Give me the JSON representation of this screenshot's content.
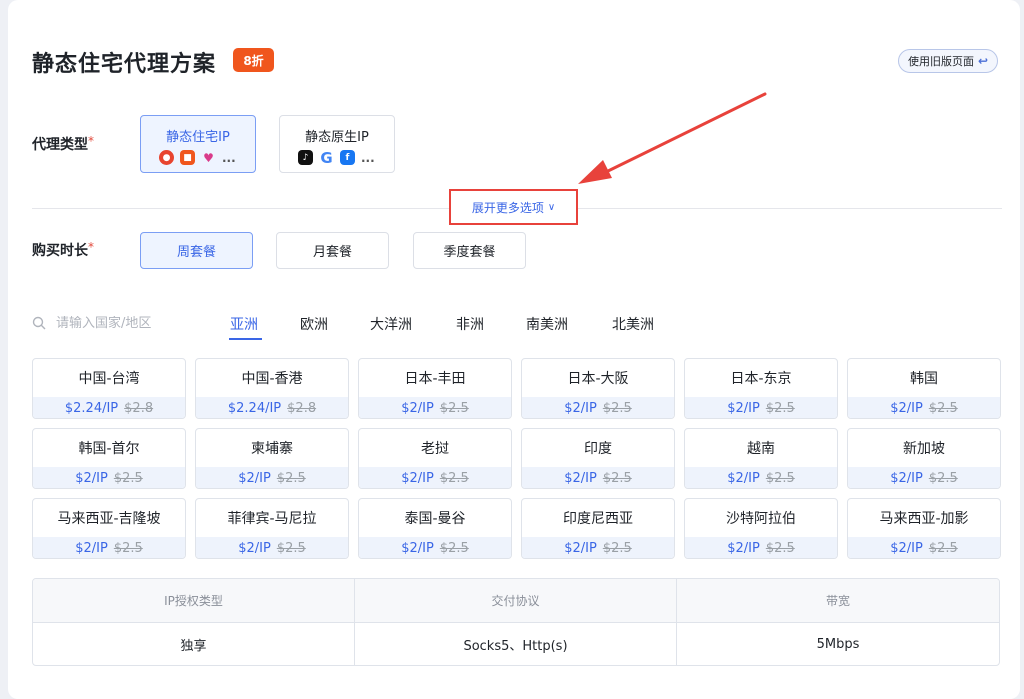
{
  "header": {
    "title": "静态住宅代理方案",
    "badge": "8折",
    "old_page_button": "使用旧版页面",
    "old_page_icon": "return-icon"
  },
  "proxy_type": {
    "label": "代理类型",
    "required_mark": "*",
    "options": [
      {
        "label": "静态住宅IP",
        "active": true,
        "icons": [
          "weibo-icon",
          "taobao-icon",
          "lazada-icon"
        ],
        "more": "..."
      },
      {
        "label": "静态原生IP",
        "active": false,
        "icons": [
          "tiktok-icon",
          "google-icon",
          "facebook-icon"
        ],
        "more": "..."
      }
    ],
    "expand_label": "展开更多选项"
  },
  "duration": {
    "label": "购买时长",
    "required_mark": "*",
    "options": [
      {
        "label": "周套餐",
        "active": true
      },
      {
        "label": "月套餐",
        "active": false
      },
      {
        "label": "季度套餐",
        "active": false
      }
    ]
  },
  "search": {
    "placeholder": "请输入国家/地区"
  },
  "regions": [
    {
      "label": "亚洲",
      "active": true
    },
    {
      "label": "欧洲",
      "active": false
    },
    {
      "label": "大洋洲",
      "active": false
    },
    {
      "label": "非洲",
      "active": false
    },
    {
      "label": "南美洲",
      "active": false
    },
    {
      "label": "北美洲",
      "active": false
    }
  ],
  "locations": [
    {
      "name": "中国-台湾",
      "price": "$2.24/IP",
      "original": "$2.8"
    },
    {
      "name": "中国-香港",
      "price": "$2.24/IP",
      "original": "$2.8"
    },
    {
      "name": "日本-丰田",
      "price": "$2/IP",
      "original": "$2.5"
    },
    {
      "name": "日本-大阪",
      "price": "$2/IP",
      "original": "$2.5"
    },
    {
      "name": "日本-东京",
      "price": "$2/IP",
      "original": "$2.5"
    },
    {
      "name": "韩国",
      "price": "$2/IP",
      "original": "$2.5"
    },
    {
      "name": "韩国-首尔",
      "price": "$2/IP",
      "original": "$2.5"
    },
    {
      "name": "柬埔寨",
      "price": "$2/IP",
      "original": "$2.5"
    },
    {
      "name": "老挝",
      "price": "$2/IP",
      "original": "$2.5"
    },
    {
      "name": "印度",
      "price": "$2/IP",
      "original": "$2.5"
    },
    {
      "name": "越南",
      "price": "$2/IP",
      "original": "$2.5"
    },
    {
      "name": "新加坡",
      "price": "$2/IP",
      "original": "$2.5"
    },
    {
      "name": "马来西亚-吉隆坡",
      "price": "$2/IP",
      "original": "$2.5"
    },
    {
      "name": "菲律宾-马尼拉",
      "price": "$2/IP",
      "original": "$2.5"
    },
    {
      "name": "泰国-曼谷",
      "price": "$2/IP",
      "original": "$2.5"
    },
    {
      "name": "印度尼西亚",
      "price": "$2/IP",
      "original": "$2.5"
    },
    {
      "name": "沙特阿拉伯",
      "price": "$2/IP",
      "original": "$2.5"
    },
    {
      "name": "马来西亚-加影",
      "price": "$2/IP",
      "original": "$2.5"
    }
  ],
  "specs": [
    {
      "header": "IP授权类型",
      "value": "独享"
    },
    {
      "header": "交付协议",
      "value": "Socks5、Http(s)"
    },
    {
      "header": "带宽",
      "value": "5Mbps"
    }
  ],
  "colors": {
    "accent": "#3a66e6",
    "badge": "#f0561d",
    "annotation": "#e8423b"
  }
}
